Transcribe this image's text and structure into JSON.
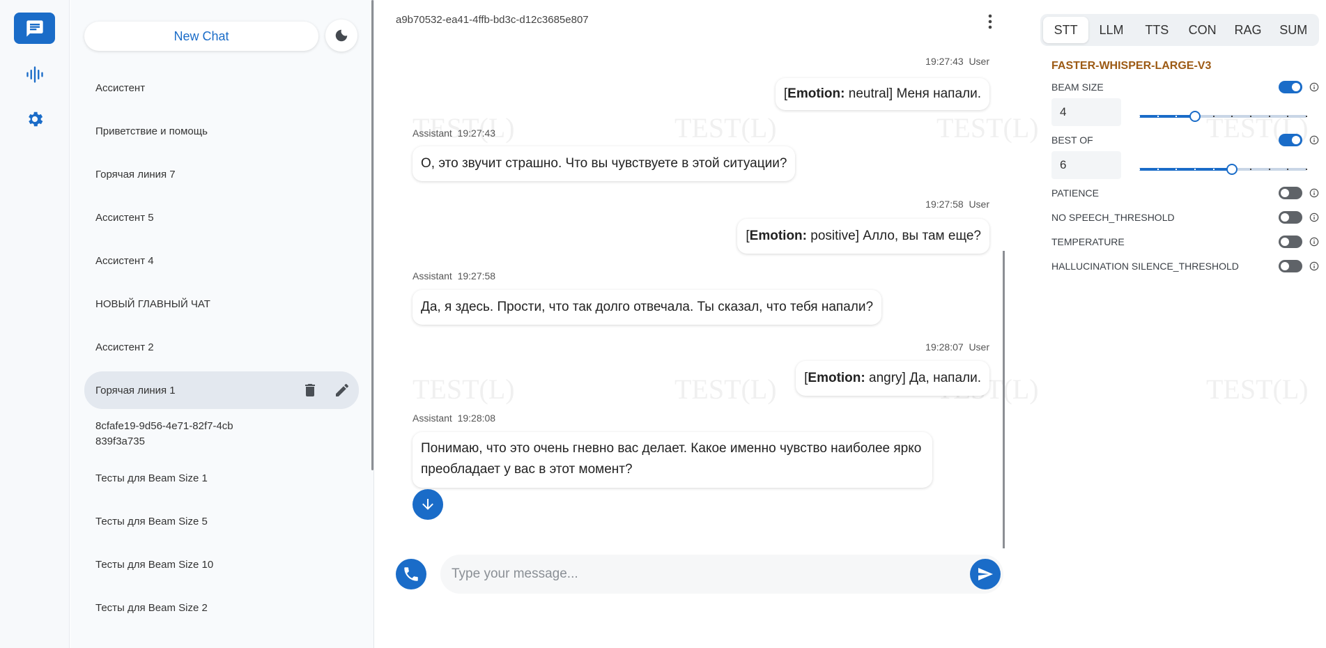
{
  "rail": {
    "items": [
      "chat-icon",
      "waveform-icon",
      "gear-icon"
    ],
    "active": "chat-icon"
  },
  "chatlist": {
    "new_chat_label": "New Chat",
    "items": [
      {
        "label": "Ассистент"
      },
      {
        "label": "Приветствие и помощь"
      },
      {
        "label": "Горячая линия 7"
      },
      {
        "label": "Ассистент 5"
      },
      {
        "label": "Ассистент 4"
      },
      {
        "label": "НОВЫЙ ГЛАВНЫЙ ЧАТ"
      },
      {
        "label": "Ассистент 2"
      },
      {
        "label": "Горячая линия 1"
      },
      {
        "label": "8cfafe19-9d56-4e71-82f7-4cb839f3a735"
      },
      {
        "label": "Тесты для Beam Size 1"
      },
      {
        "label": "Тесты для Beam Size 5"
      },
      {
        "label": "Тесты для Beam Size 10"
      },
      {
        "label": "Тесты для Beam Size 2"
      }
    ],
    "selected_index": 7
  },
  "chat": {
    "id": "a9b70532-ea41-4ffb-bd3c-d12c3685e807",
    "messages": [
      {
        "role": "User",
        "time": "19:27:43",
        "emotion_label": "Emotion:",
        "emotion": "neutral",
        "text": "Меня напали."
      },
      {
        "role": "Assistant",
        "time": "19:27:43",
        "text": "О, это звучит страшно. Что вы чувствуете в этой ситуации?"
      },
      {
        "role": "User",
        "time": "19:27:58",
        "emotion_label": "Emotion:",
        "emotion": "positive",
        "text": "Алло, вы там еще?"
      },
      {
        "role": "Assistant",
        "time": "19:27:58",
        "text": "Да, я здесь. Прости, что так долго отвечала. Ты сказал, что тебя напали?"
      },
      {
        "role": "User",
        "time": "19:28:07",
        "emotion_label": "Emotion:",
        "emotion": "angry",
        "text": "Да, напали."
      },
      {
        "role": "Assistant",
        "time": "19:28:08",
        "text": "Понимаю, что это очень гневно вас делает. Какое именно чувство наиболее ярко преобладает у вас в этот момент?"
      }
    ],
    "input_placeholder": "Type your message...",
    "watermark": "TEST(L)"
  },
  "settings": {
    "tabs": [
      "STT",
      "LLM",
      "TTS",
      "CON",
      "RAG",
      "SUM"
    ],
    "active_tab": "STT",
    "model_name": "FASTER-WHISPER-LARGE-V3",
    "params": [
      {
        "label": "BEAM SIZE",
        "enabled": true,
        "value": "4",
        "slider": {
          "min": 1,
          "max": 10,
          "value": 4
        }
      },
      {
        "label": "BEST OF",
        "enabled": true,
        "value": "6",
        "slider": {
          "min": 1,
          "max": 10,
          "value": 6
        }
      },
      {
        "label": "PATIENCE",
        "enabled": false
      },
      {
        "label": "NO SPEECH_THRESHOLD",
        "enabled": false
      },
      {
        "label": "TEMPERATURE",
        "enabled": false
      },
      {
        "label": "HALLUCINATION SILENCE_THRESHOLD",
        "enabled": false
      }
    ]
  },
  "colors": {
    "accent": "#1a6cc8",
    "model_name": "#9c5a14"
  }
}
